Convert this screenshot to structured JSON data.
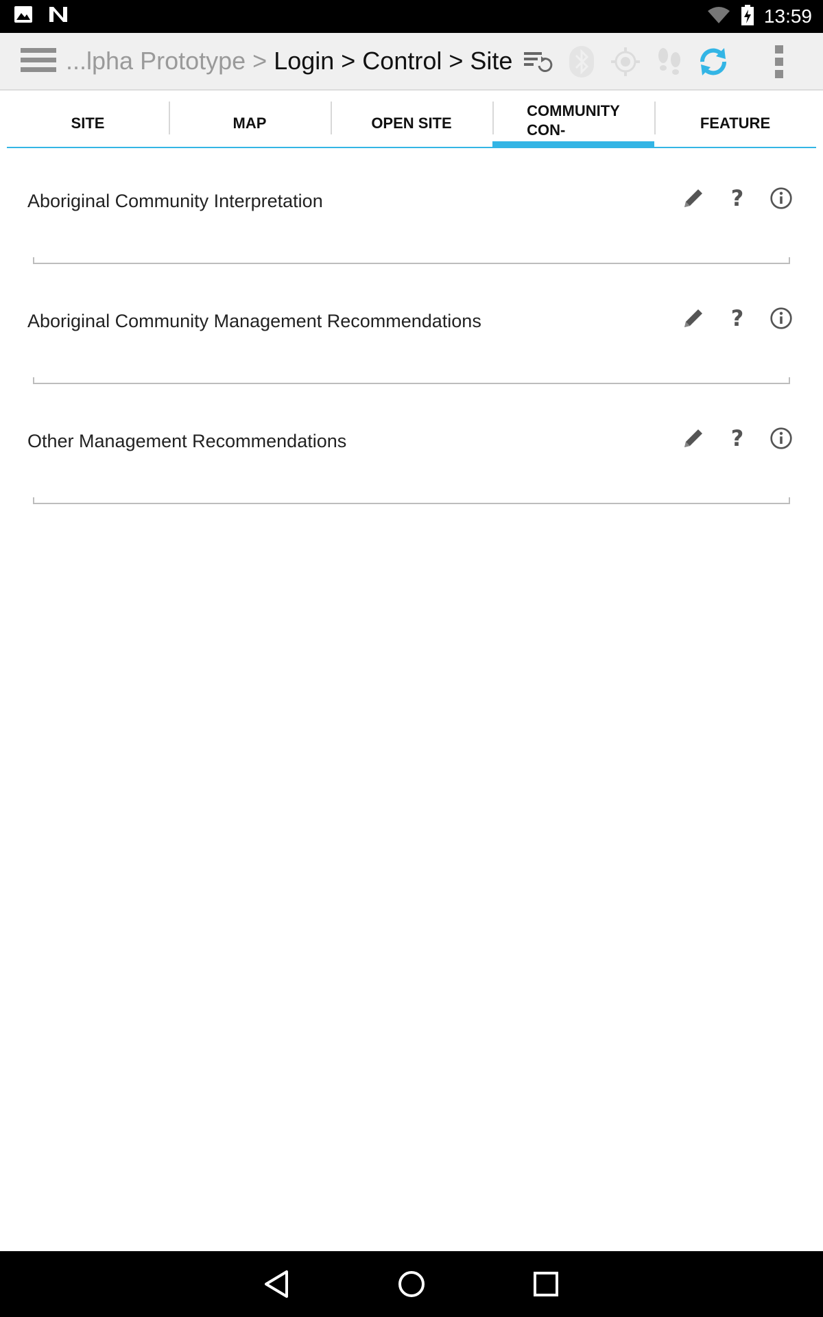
{
  "status_bar": {
    "time": "13:59",
    "left_icons": [
      "image-notification-icon",
      "n-notification-icon"
    ],
    "right_icons": [
      "wifi-icon",
      "battery-charging-icon"
    ]
  },
  "action_bar": {
    "breadcrumb_faded": "...lpha Prototype > ",
    "breadcrumb_dark": "Login > Control > Site",
    "icons": [
      "menu-icon",
      "sync-list-icon",
      "bluetooth-icon",
      "gps-icon",
      "footsteps-icon",
      "refresh-icon",
      "overflow-icon"
    ],
    "accent_color": "#33b5e5"
  },
  "tabs": [
    {
      "label": "SITE",
      "active": false
    },
    {
      "label": "MAP",
      "active": false
    },
    {
      "label": "OPEN SITE",
      "active": false
    },
    {
      "label_line1": "COMMUNITY",
      "label_line2": "CON-",
      "active": true
    },
    {
      "label": "FEATURE",
      "active": false
    }
  ],
  "fields": [
    {
      "label": "Aboriginal Community Interpretation",
      "value": "",
      "help": "?"
    },
    {
      "label": "Aboriginal Community Management Recommendations",
      "value": "",
      "help": "?"
    },
    {
      "label": "Other Management Recommendations",
      "value": "",
      "help": "?"
    }
  ],
  "nav_bar": {
    "buttons": [
      "back-icon",
      "home-icon",
      "recents-icon"
    ]
  }
}
